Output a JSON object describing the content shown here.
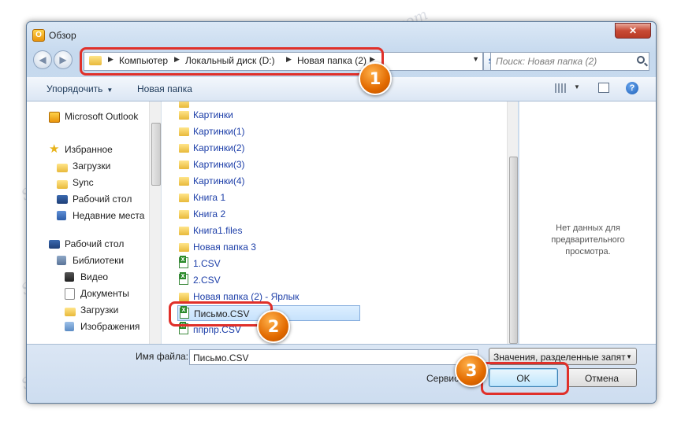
{
  "window": {
    "title": "Обзор",
    "close_glyph": "✕"
  },
  "nav": {
    "back_glyph": "◀",
    "forward_glyph": "▶",
    "breadcrumbs": [
      "Компьютер",
      "Локальный диск (D:)",
      "Новая папка (2)"
    ],
    "search_placeholder": "Поиск: Новая папка (2)"
  },
  "toolbar": {
    "organize_label": "Упорядочить",
    "new_folder_label": "Новая папка"
  },
  "sidebar": {
    "items": [
      {
        "label": "Microsoft Outlook",
        "icon": "outlook-icon"
      },
      {
        "label": "Избранное",
        "icon": "star-icon"
      },
      {
        "label": "Загрузки",
        "icon": "downloads-folder-icon"
      },
      {
        "label": "Sync",
        "icon": "folder-icon"
      },
      {
        "label": "Рабочий стол",
        "icon": "desktop-icon"
      },
      {
        "label": "Недавние места",
        "icon": "recent-places-icon"
      },
      {
        "label": "Рабочий стол",
        "icon": "desktop-icon"
      },
      {
        "label": "Библиотеки",
        "icon": "libraries-icon"
      },
      {
        "label": "Видео",
        "icon": "video-library-icon"
      },
      {
        "label": "Документы",
        "icon": "documents-library-icon"
      },
      {
        "label": "Загрузки",
        "icon": "downloads-folder-icon"
      },
      {
        "label": "Изображения",
        "icon": "pictures-library-icon"
      }
    ]
  },
  "files": {
    "items": [
      {
        "name": "Картинки",
        "type": "folder"
      },
      {
        "name": "Картинки(1)",
        "type": "folder"
      },
      {
        "name": "Картинки(2)",
        "type": "folder"
      },
      {
        "name": "Картинки(3)",
        "type": "folder"
      },
      {
        "name": "Картинки(4)",
        "type": "folder"
      },
      {
        "name": "Книга 1",
        "type": "folder"
      },
      {
        "name": "Книга 2",
        "type": "folder"
      },
      {
        "name": "Книга1.files",
        "type": "folder"
      },
      {
        "name": "Новая папка 3",
        "type": "folder"
      },
      {
        "name": "1.CSV",
        "type": "csv"
      },
      {
        "name": "2.CSV",
        "type": "csv"
      },
      {
        "name": "Новая папка (2) - Ярлык",
        "type": "shortcut"
      },
      {
        "name": "Письмо.CSV",
        "type": "csv",
        "selected": true
      },
      {
        "name": "ппрпр.CSV",
        "type": "csv"
      }
    ]
  },
  "preview": {
    "text": "Нет данных для\nпредварительного\nпросмотра."
  },
  "footer": {
    "filename_label": "Имя файла:",
    "filename_value": "Письмо.CSV",
    "filetype_value": "Значения, разделенные запят",
    "tools_label": "Сервис",
    "ok_label": "OK",
    "cancel_label": "Отмена"
  },
  "annotations": {
    "badge_1": "1",
    "badge_2": "2",
    "badge_3": "3",
    "watermark": "Soringpcrepair.com"
  }
}
